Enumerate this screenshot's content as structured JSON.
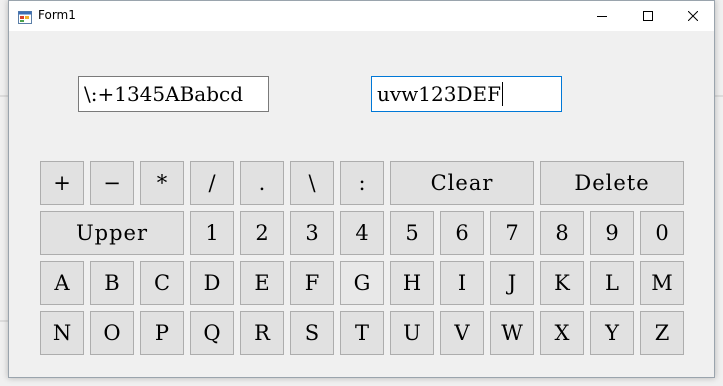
{
  "window": {
    "title": "Form1"
  },
  "textboxes": {
    "left_value": "\\:+1345ABabcd",
    "right_value": "uvw123DEF"
  },
  "keys": {
    "plus": "+",
    "minus": "−",
    "multiply": "*",
    "divide": "/",
    "dot": ".",
    "backslash": "\\",
    "colon": ":",
    "clear": "Clear",
    "delete": "Delete",
    "upper": "Upper",
    "d1": "1",
    "d2": "2",
    "d3": "3",
    "d4": "4",
    "d5": "5",
    "d6": "6",
    "d7": "7",
    "d8": "8",
    "d9": "9",
    "d0": "0",
    "A": "A",
    "B": "B",
    "C": "C",
    "D": "D",
    "E": "E",
    "F": "F",
    "G": "G",
    "H": "H",
    "I": "I",
    "J": "J",
    "K": "K",
    "L": "L",
    "M": "M",
    "N": "N",
    "O": "O",
    "P": "P",
    "Q": "Q",
    "R": "R",
    "S": "S",
    "T": "T",
    "U": "U",
    "V": "V",
    "W": "W",
    "X": "X",
    "Y": "Y",
    "Z": "Z"
  },
  "icons": {
    "app": "form-app-icon",
    "minimize": "minimize-icon",
    "maximize": "maximize-icon",
    "close": "close-icon"
  }
}
